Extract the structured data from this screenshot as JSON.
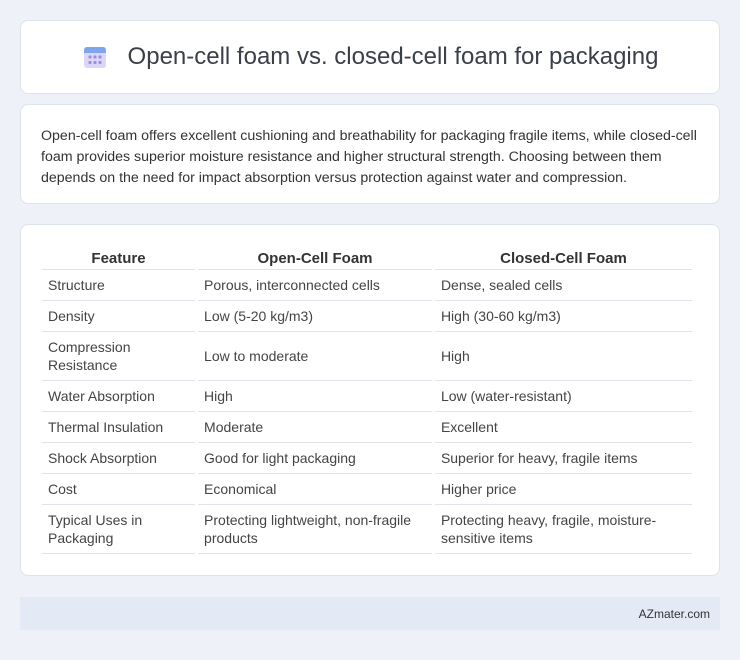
{
  "header": {
    "title": "Open-cell foam vs. closed-cell foam for packaging",
    "icon": "calendar-icon"
  },
  "summary": "Open-cell foam offers excellent cushioning and breathability for packaging fragile items, while closed-cell foam provides superior moisture resistance and higher structural strength. Choosing between them depends on the need for impact absorption versus protection against water and compression.",
  "table": {
    "headers": [
      "Feature",
      "Open-Cell Foam",
      "Closed-Cell Foam"
    ],
    "rows": [
      [
        "Structure",
        "Porous, interconnected cells",
        "Dense, sealed cells"
      ],
      [
        "Density",
        "Low (5-20 kg/m3)",
        "High (30-60 kg/m3)"
      ],
      [
        "Compression Resistance",
        "Low to moderate",
        "High"
      ],
      [
        "Water Absorption",
        "High",
        "Low (water-resistant)"
      ],
      [
        "Thermal Insulation",
        "Moderate",
        "Excellent"
      ],
      [
        "Shock Absorption",
        "Good for light packaging",
        "Superior for heavy, fragile items"
      ],
      [
        "Cost",
        "Economical",
        "Higher price"
      ],
      [
        "Typical Uses in Packaging",
        "Protecting lightweight, non-fragile products",
        "Protecting heavy, fragile, moisture-sensitive items"
      ]
    ]
  },
  "footer": {
    "brand": "AZmater.com"
  },
  "colors": {
    "background": "#eef2f8",
    "footer_bg": "#e3eaf6",
    "icon_accent": "#8b7fd8"
  }
}
